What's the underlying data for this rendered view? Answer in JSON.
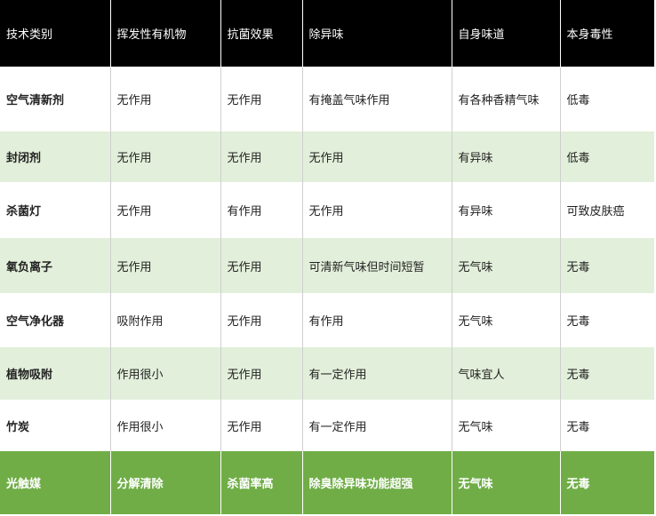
{
  "table": {
    "headers": [
      "技术类别",
      "挥发性有机物",
      "抗菌效果",
      "除异味",
      "自身味道",
      "本身毒性"
    ],
    "rows": [
      [
        "空气清新剂",
        "无作用",
        "无作用",
        "有掩盖气味作用",
        "有各种香精气味",
        "低毒"
      ],
      [
        "封闭剂",
        "无作用",
        "无作用",
        "无作用",
        "有异味",
        "低毒"
      ],
      [
        "杀菌灯",
        "无作用",
        "有作用",
        "无作用",
        "有异味",
        "可致皮肤癌"
      ],
      [
        "氧负离子",
        "无作用",
        "无作用",
        "可清新气味但时间短暂",
        "无气味",
        "无毒"
      ],
      [
        "空气净化器",
        "吸附作用",
        "无作用",
        "有作用",
        "无气味",
        "无毒"
      ],
      [
        "植物吸附",
        "作用很小",
        "无作用",
        "有一定作用",
        "气味宜人",
        "无毒"
      ],
      [
        "竹炭",
        "作用很小",
        "无作用",
        "有一定作用",
        "无气味",
        "无毒"
      ],
      [
        "光触媒",
        "分解清除",
        "杀菌率高",
        "除臭除异味功能超强",
        "无气味",
        "无毒"
      ]
    ]
  },
  "colors": {
    "header_bg": "#000000",
    "alt_row_bg": "#e2efda",
    "highlight_row_bg": "#70ad47"
  }
}
